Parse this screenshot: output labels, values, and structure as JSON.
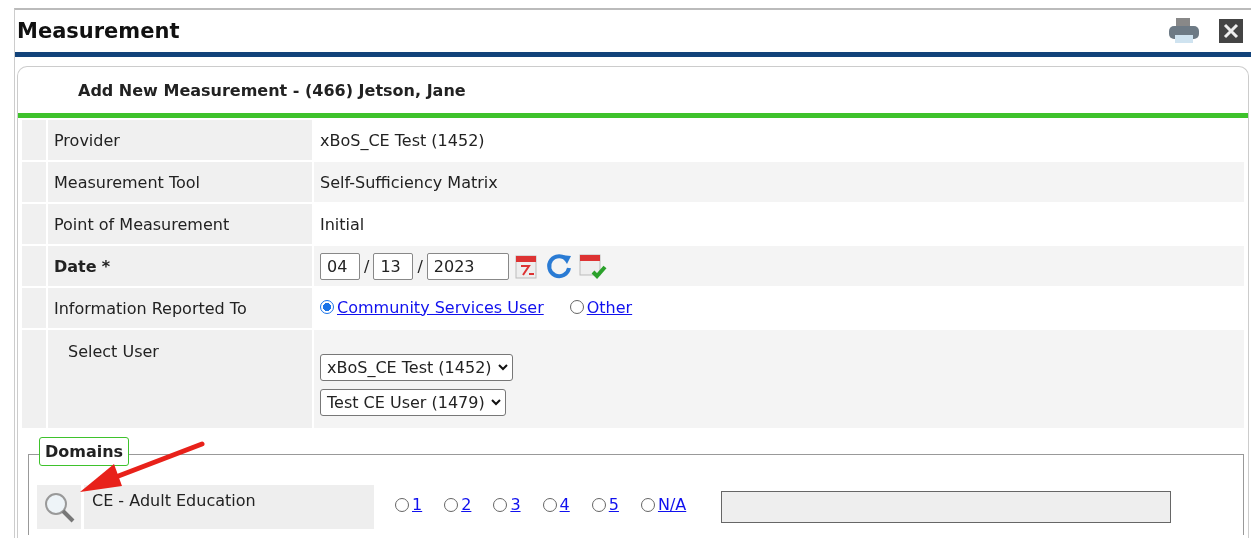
{
  "window": {
    "title": "Measurement"
  },
  "header": {
    "title": "Add New Measurement - (466) Jetson, Jane"
  },
  "fields": [
    {
      "kind": "text",
      "label": "Provider",
      "value": "xBoS_CE Test (1452)"
    },
    {
      "kind": "text",
      "label": "Measurement Tool",
      "value": "Self-Sufficiency Matrix"
    },
    {
      "kind": "text",
      "label": "Point of Measurement",
      "value": "Initial"
    },
    {
      "kind": "date",
      "label": "Date",
      "required_mark": "*",
      "month": "04",
      "day": "13",
      "year": "2023",
      "separator": "/"
    },
    {
      "kind": "radio",
      "label": "Information Reported To",
      "options": [
        {
          "label": "Community Services User",
          "selected": true
        },
        {
          "label": "Other",
          "selected": false
        }
      ]
    },
    {
      "kind": "selects",
      "label": "Select User",
      "selects": [
        "xBoS_CE Test (1452)",
        "Test CE User (1479)"
      ]
    }
  ],
  "domains": {
    "legend": "Domains",
    "rows": [
      {
        "name": "CE - Adult Education",
        "options": [
          {
            "label": "1",
            "selected": false
          },
          {
            "label": "2",
            "selected": false
          },
          {
            "label": "3",
            "selected": false
          },
          {
            "label": "4",
            "selected": false
          },
          {
            "label": "5",
            "selected": false
          },
          {
            "label": "N/A",
            "selected": false
          }
        ]
      }
    ]
  }
}
